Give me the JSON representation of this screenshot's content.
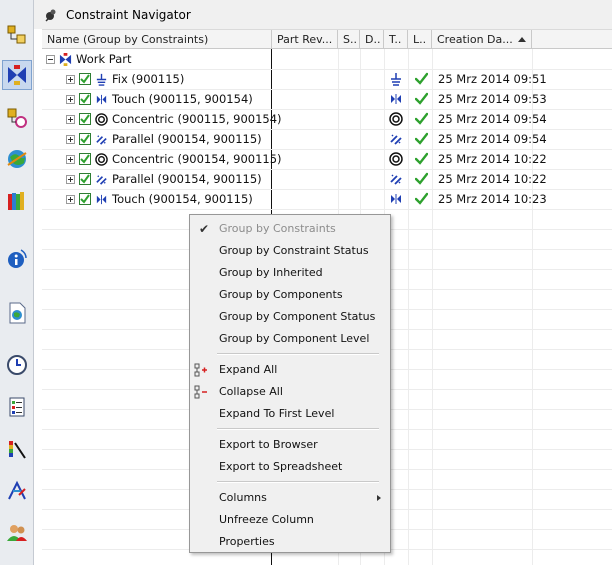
{
  "sidebar": {
    "icons": [
      "assembly-navigator-icon",
      "constraint-navigator-icon",
      "part-navigator-icon",
      "reuse-library-icon",
      "history-icon",
      "information-icon",
      "web-browser-icon",
      "clock-icon",
      "process-studio-icon",
      "palette-icon",
      "role-icon",
      "people-icon"
    ]
  },
  "panel": {
    "title": "Constraint Navigator",
    "columns": [
      "Name (Group by Constraints)",
      "Part Rev...",
      "S..",
      "D..",
      "T..",
      "L..",
      "Creation Da..."
    ]
  },
  "tree": {
    "root_label": "Work Part",
    "rows": [
      {
        "label": "Fix (900115)",
        "icon": "fix-icon",
        "date": "25 Mrz 2014 09:51"
      },
      {
        "label": "Touch (900115, 900154)",
        "icon": "touch-icon",
        "date": "25 Mrz 2014 09:53"
      },
      {
        "label": "Concentric (900115, 900154)",
        "icon": "concentric-icon",
        "date": "25 Mrz 2014 09:54"
      },
      {
        "label": "Parallel (900154, 900115)",
        "icon": "parallel-icon",
        "date": "25 Mrz 2014 09:54"
      },
      {
        "label": "Concentric (900154, 900115)",
        "icon": "concentric-icon",
        "date": "25 Mrz 2014 10:22"
      },
      {
        "label": "Parallel (900154, 900115)",
        "icon": "parallel-icon",
        "date": "25 Mrz 2014 10:22"
      },
      {
        "label": "Touch (900154, 900115)",
        "icon": "touch-icon",
        "date": "25 Mrz 2014 10:23"
      }
    ]
  },
  "context_menu": {
    "items": [
      {
        "label": "Group by Constraints",
        "disabled": true,
        "checked": true
      },
      {
        "label": "Group by Constraint Status"
      },
      {
        "label": "Group by Inherited"
      },
      {
        "label": "Group by Components"
      },
      {
        "label": "Group by Component Status"
      },
      {
        "label": "Group by Component Level"
      },
      {
        "label": "Expand All",
        "icon": "expand-all-icon"
      },
      {
        "label": "Collapse All",
        "icon": "collapse-all-icon"
      },
      {
        "label": "Expand To First Level"
      },
      {
        "label": "Export to Browser"
      },
      {
        "label": "Export to Spreadsheet"
      },
      {
        "label": "Columns",
        "submenu": true
      },
      {
        "label": "Unfreeze Column"
      },
      {
        "label": "Properties"
      }
    ]
  },
  "colors": {
    "check_green": "#2ea12e",
    "constraint_blue": "#1f3fb3",
    "menu_bg": "#f0f0f0",
    "disabled_text": "#8c8c8c"
  }
}
